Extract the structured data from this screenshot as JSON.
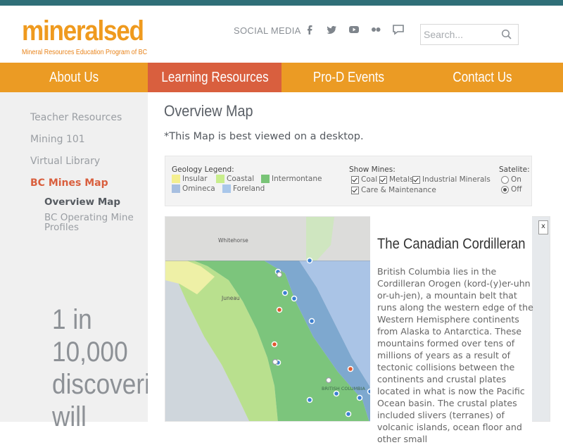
{
  "header": {
    "logo_word": "mineralsed",
    "logo_tagline": "Mineral Resources Education Program of BC",
    "social_label": "SOCIAL MEDIA",
    "social_icons": [
      "facebook-icon",
      "twitter-icon",
      "youtube-icon",
      "flickr-icon",
      "chat-icon"
    ],
    "search_placeholder": "Search..."
  },
  "nav": {
    "items": [
      {
        "label": "About Us"
      },
      {
        "label": "Learning Resources"
      },
      {
        "label": "Pro-D Events"
      },
      {
        "label": "Contact Us"
      }
    ],
    "active_index": 1
  },
  "sidebar": {
    "items": [
      {
        "label": "Teacher Resources"
      },
      {
        "label": "Mining 101"
      },
      {
        "label": "Virtual Library"
      },
      {
        "label": "BC Mines Map"
      }
    ],
    "subitems": [
      {
        "label": "Overview Map"
      },
      {
        "label": "BC Operating Mine Profiles"
      }
    ],
    "promo_lines": [
      "1 in",
      "10,000",
      "discoveries",
      "will"
    ]
  },
  "main": {
    "title": "Overview Map",
    "note": "*This Map is best viewed on a desktop."
  },
  "legend": {
    "geology_heading": "Geology Legend:",
    "geology": [
      {
        "label": "Insular",
        "color": "#f4ef8f"
      },
      {
        "label": "Coastal",
        "color": "#c8ee8c"
      },
      {
        "label": "Intermontane",
        "color": "#79c477"
      },
      {
        "label": "Omineca",
        "color": "#a7bfe0"
      },
      {
        "label": "Foreland",
        "color": "#a9c7ea"
      }
    ],
    "mines_heading": "Show Mines:",
    "mines": [
      {
        "label": "Coal",
        "checked": true
      },
      {
        "label": "Metals",
        "checked": true
      },
      {
        "label": "Industrial Minerals",
        "checked": true
      },
      {
        "label": "Care & Maintenance",
        "checked": true
      }
    ],
    "satellite_heading": "Satelite:",
    "satellite_options": [
      {
        "label": "On",
        "selected": false
      },
      {
        "label": "Off",
        "selected": true
      }
    ]
  },
  "map": {
    "labels": [
      "Whitehorse",
      "Juneau",
      "BRITISH COLUMBIA"
    ],
    "close_label": "x"
  },
  "info_panel": {
    "title": "The Canadian Cordilleran",
    "text": "British Columbia lies in the Cordilleran Orogen (kord-(y)er-uhn or-uh-jen), a mountain belt that runs along the western edge of the Western Hemisphere continents from Alaska to Antarctica.  These mountains formed over tens of millions of years as a result of tectonic collisions between the continents and crustal plates located in what is now the Pacific Ocean basin. The crustal plates included slivers (terranes) of volcanic islands, ocean floor and other small"
  },
  "colors": {
    "topbar": "#2f6f78",
    "nav_bg": "#eb9b24",
    "nav_active": "#d95f3e",
    "logo": "#ef9a1e",
    "sidebar_active": "#d95f3e"
  }
}
